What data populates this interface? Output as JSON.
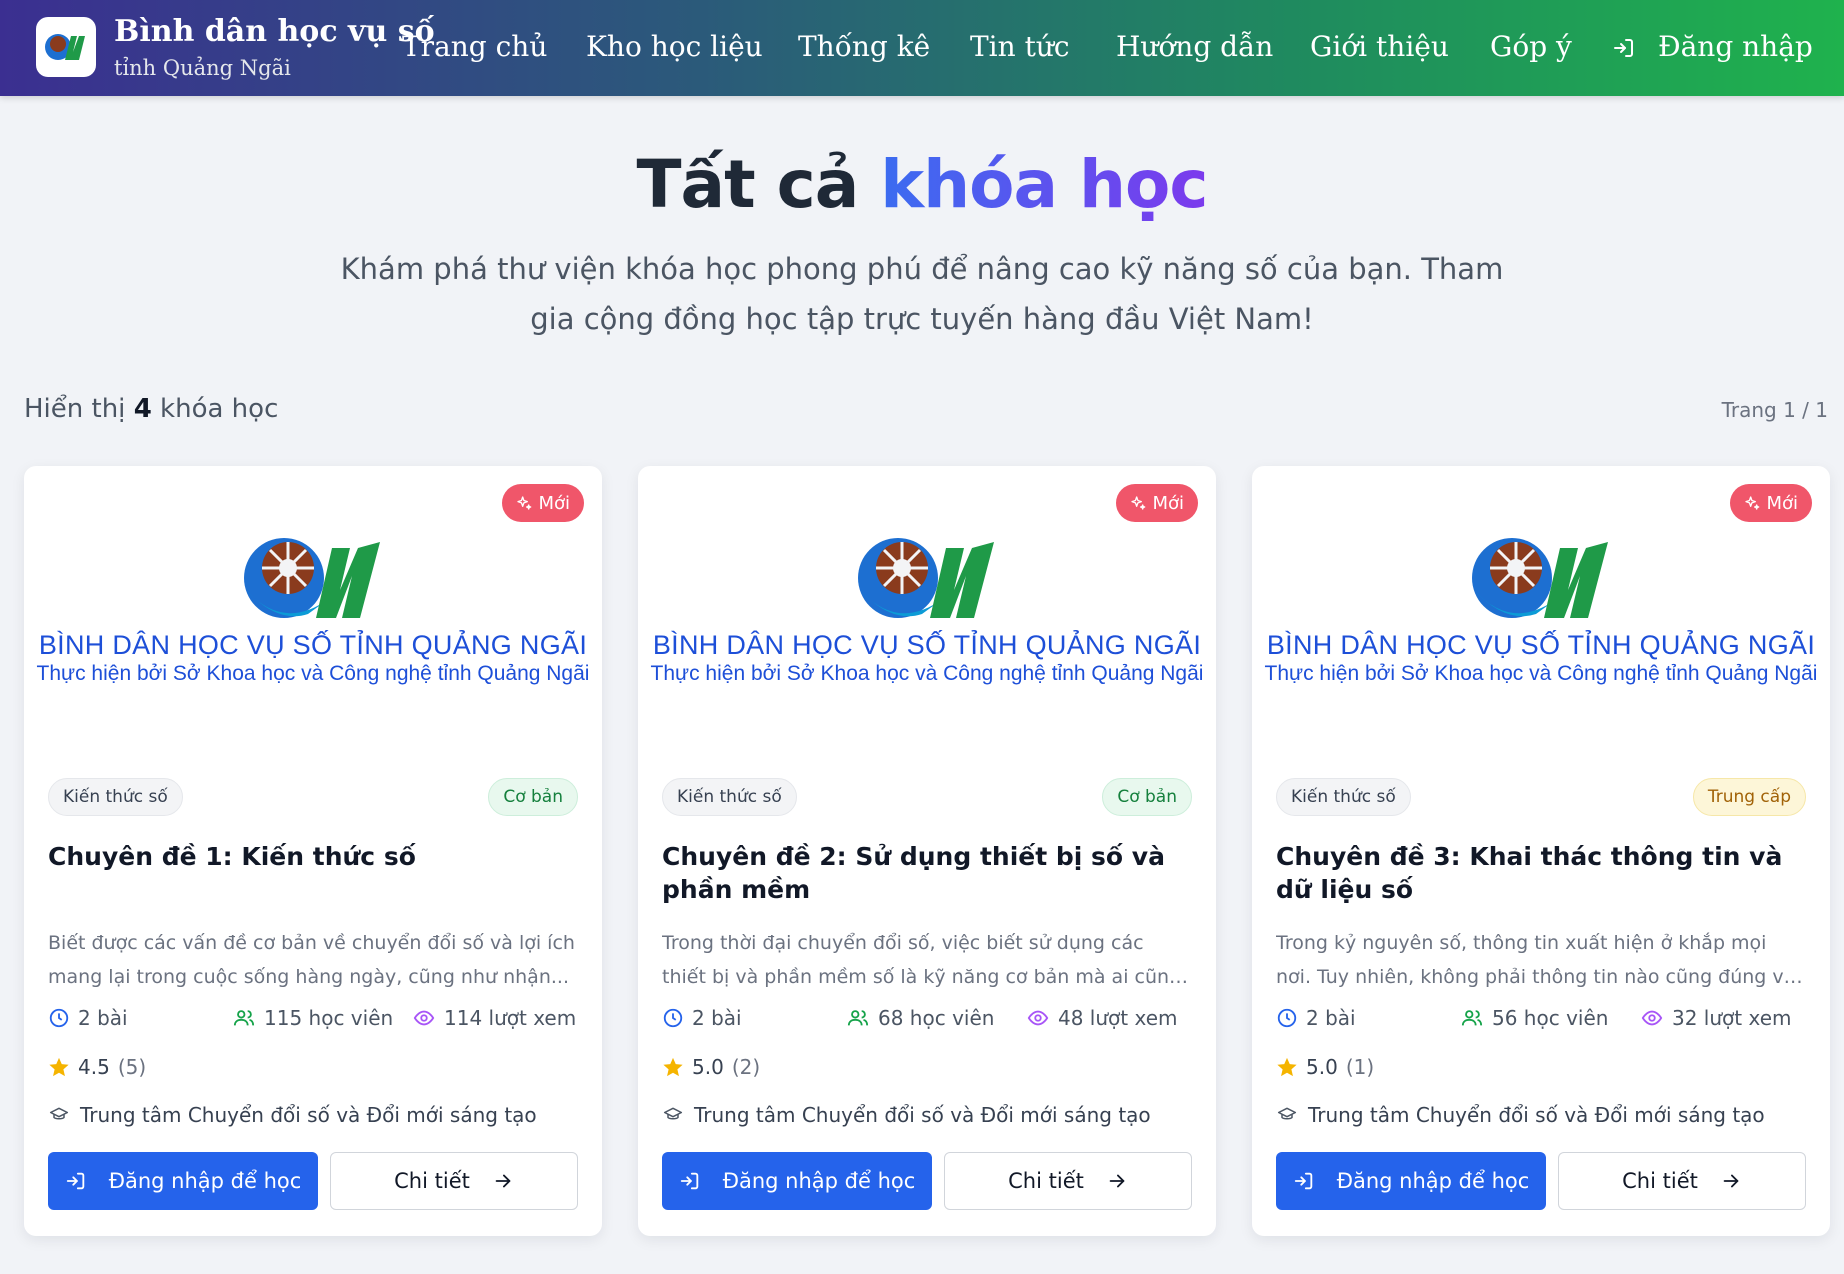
{
  "header": {
    "brand_title": "Bình dân học vụ số",
    "brand_subtitle": "tỉnh Quảng Ngãi",
    "nav": [
      "Trang chủ",
      "Kho học liệu",
      "Thống kê",
      "Tin tức",
      "Hướng dẫn",
      "Giới thiệu",
      "Góp ý"
    ],
    "login_label": "Đăng nhập",
    "logo_icon": "ql-logo-icon",
    "login_icon": "login-icon"
  },
  "hero": {
    "title_plain": "Tất cả",
    "title_accent": "khóa học",
    "description": "Khám phá thư viện khóa học phong phú để nâng cao kỹ năng số của bạn. Tham gia cộng đồng học tập trực tuyến hàng đầu Việt Nam!"
  },
  "results": {
    "prefix": "Hiển thị",
    "count": "4",
    "suffix": "khóa học",
    "page": "Trang 1 / 1"
  },
  "colors": {
    "primary": "#2563eb",
    "new_badge": "#f0566a",
    "banner_text": "#1d4fd8"
  },
  "courses": [
    {
      "badge": "Mới",
      "banner_title": "BÌNH DÂN HỌC VỤ SỐ TỈNH QUẢNG NGÃI",
      "banner_subtitle": "Thực hiện bởi Sở Khoa học và Công nghệ tỉnh Quảng Ngãi",
      "category": "Kiến thức số",
      "level": "Cơ bản",
      "title": "Chuyên đề 1: Kiến thức số",
      "description": "Biết được các vấn đề cơ bản về chuyển đổi số và lợi ích mang lại trong cuộc sống hàng ngày, cũng như nhận...",
      "lessons": "2 bài",
      "students": "115 học viên",
      "views": "114 lượt xem",
      "rating": "4.5",
      "rating_count": "(5)",
      "organization": "Trung tâm Chuyển đổi số và Đổi mới sáng tạo",
      "login_button": "Đăng nhập để học",
      "detail_button": "Chi tiết"
    },
    {
      "badge": "Mới",
      "banner_title": "BÌNH DÂN HỌC VỤ SỐ TỈNH QUẢNG NGÃI",
      "banner_subtitle": "Thực hiện bởi Sở Khoa học và Công nghệ tỉnh Quảng Ngãi",
      "category": "Kiến thức số",
      "level": "Cơ bản",
      "title": "Chuyên đề 2: Sử dụng thiết bị số và phần mềm",
      "description": "Trong thời đại chuyển đổi số, việc biết sử dụng các thiết bị và phần mềm số là kỹ năng cơ bản mà ai cũng cần c...",
      "lessons": "2 bài",
      "students": "68 học viên",
      "views": "48 lượt xem",
      "rating": "5.0",
      "rating_count": "(2)",
      "organization": "Trung tâm Chuyển đổi số và Đổi mới sáng tạo",
      "login_button": "Đăng nhập để học",
      "detail_button": "Chi tiết"
    },
    {
      "badge": "Mới",
      "banner_title": "BÌNH DÂN HỌC VỤ SỐ TỈNH QUẢNG NGÃI",
      "banner_subtitle": "Thực hiện bởi Sở Khoa học và Công nghệ tỉnh Quảng Ngãi",
      "category": "Kiến thức số",
      "level": "Trung cấp",
      "title": "Chuyên đề 3: Khai thác thông tin và dữ liệu số",
      "description": "Trong kỷ nguyên số, thông tin xuất hiện ở khắp mọi nơi. Tuy nhiên, không phải thông tin nào cũng đúng và hữu...",
      "lessons": "2 bài",
      "students": "56 học viên",
      "views": "32 lượt xem",
      "rating": "5.0",
      "rating_count": "(1)",
      "organization": "Trung tâm Chuyển đổi số và Đổi mới sáng tạo",
      "login_button": "Đăng nhập để học",
      "detail_button": "Chi tiết"
    }
  ]
}
